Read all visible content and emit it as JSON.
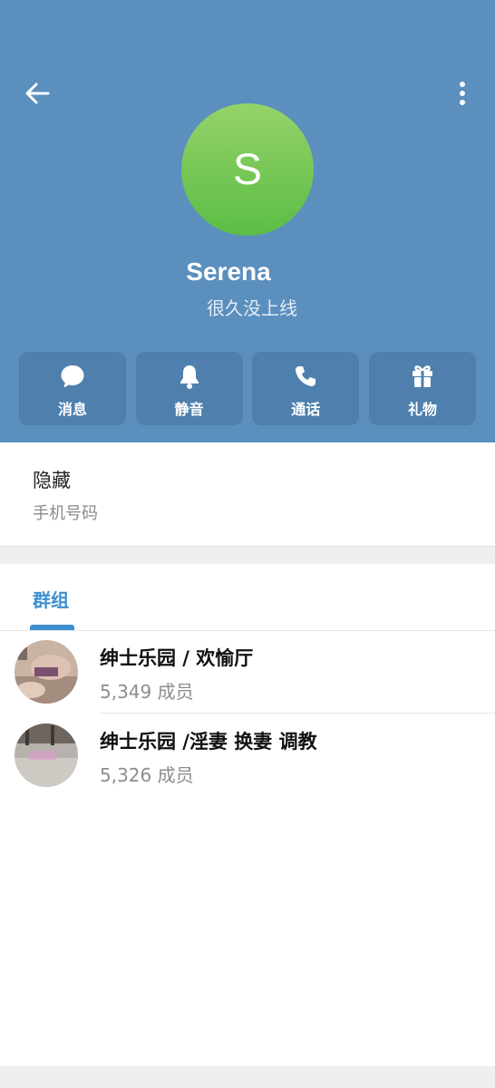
{
  "colors": {
    "header": "#5a8fbe",
    "action_bg": "#4f80ad",
    "accent": "#3d8fd0",
    "avatar_top": "#95d26a",
    "avatar_bottom": "#5bbd45"
  },
  "header": {
    "back_icon": "arrow-left-icon",
    "more_icon": "more-vertical-icon",
    "avatar_letter": "S",
    "name": "Serena",
    "status": "很久没上线"
  },
  "actions": [
    {
      "icon": "chat-bubble-icon",
      "label": "消息"
    },
    {
      "icon": "bell-icon",
      "label": "静音"
    },
    {
      "icon": "phone-icon",
      "label": "通话"
    },
    {
      "icon": "gift-icon",
      "label": "礼物"
    }
  ],
  "info": {
    "value": "隐藏",
    "label": "手机号码"
  },
  "tabs": [
    {
      "label": "群组"
    }
  ],
  "groups": [
    {
      "title": "绅士乐园 / 欢愉厅",
      "members": "5,349 成员"
    },
    {
      "title": "绅士乐园 /淫妻 换妻 调教",
      "members": "5,326 成员"
    }
  ]
}
